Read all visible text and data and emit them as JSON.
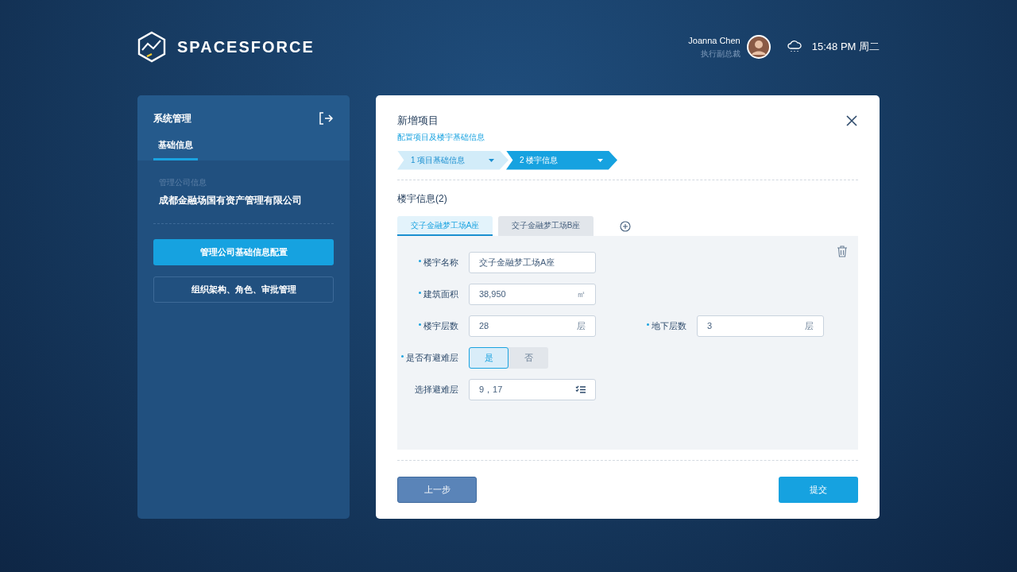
{
  "header": {
    "brand": "SPACESFORCE",
    "user": {
      "name": "Joanna Chen",
      "role": "执行副总裁"
    },
    "time": "15:48 PM 周二"
  },
  "sidebar": {
    "title": "系统管理",
    "tabs": [
      {
        "label": "基础信息",
        "selected": true
      }
    ],
    "info_label": "管理公司信息",
    "company": "成都金融场国有资产管理有限公司",
    "items": [
      {
        "label": "管理公司基础信息配置",
        "selected": true
      },
      {
        "label": "组织架构、角色、审批管理",
        "selected": false
      }
    ]
  },
  "dialog": {
    "title": "新增项目",
    "subtitle": "配置项目及楼宇基础信息",
    "steps": [
      {
        "label": "1 项目基础信息",
        "selected": false
      },
      {
        "label": "2 楼宇信息",
        "selected": true
      }
    ],
    "section_title": "楼宇信息(2)",
    "building_tabs": [
      {
        "label": "交子金融梦工场A座",
        "selected": true
      },
      {
        "label": "交子金融梦工场B座",
        "selected": false
      }
    ],
    "form_rows": [
      {
        "fields": [
          {
            "kind": "input",
            "label": "楼宇名称",
            "required": true,
            "value": "交子金融梦工场A座"
          }
        ]
      },
      {
        "fields": [
          {
            "kind": "input",
            "label": "建筑面积",
            "required": true,
            "value": "38,950",
            "unit": "㎡"
          }
        ]
      },
      {
        "fields": [
          {
            "kind": "input",
            "label": "楼宇层数",
            "required": true,
            "value": "28",
            "unit": "层"
          },
          {
            "kind": "input",
            "label": "地下层数",
            "required": true,
            "value": "3",
            "unit": "层"
          }
        ]
      },
      {
        "fields": [
          {
            "kind": "toggle",
            "label": "是否有避难层",
            "required": true,
            "options": [
              {
                "label": "是",
                "selected": true
              },
              {
                "label": "否",
                "selected": false
              }
            ]
          }
        ]
      },
      {
        "fields": [
          {
            "kind": "picker",
            "label": "选择避难层",
            "required": false,
            "value": "9，17"
          }
        ]
      }
    ],
    "buttons": [
      {
        "kind": "secondary",
        "label": "上一步"
      },
      {
        "kind": "primary",
        "label": "提交"
      }
    ]
  }
}
